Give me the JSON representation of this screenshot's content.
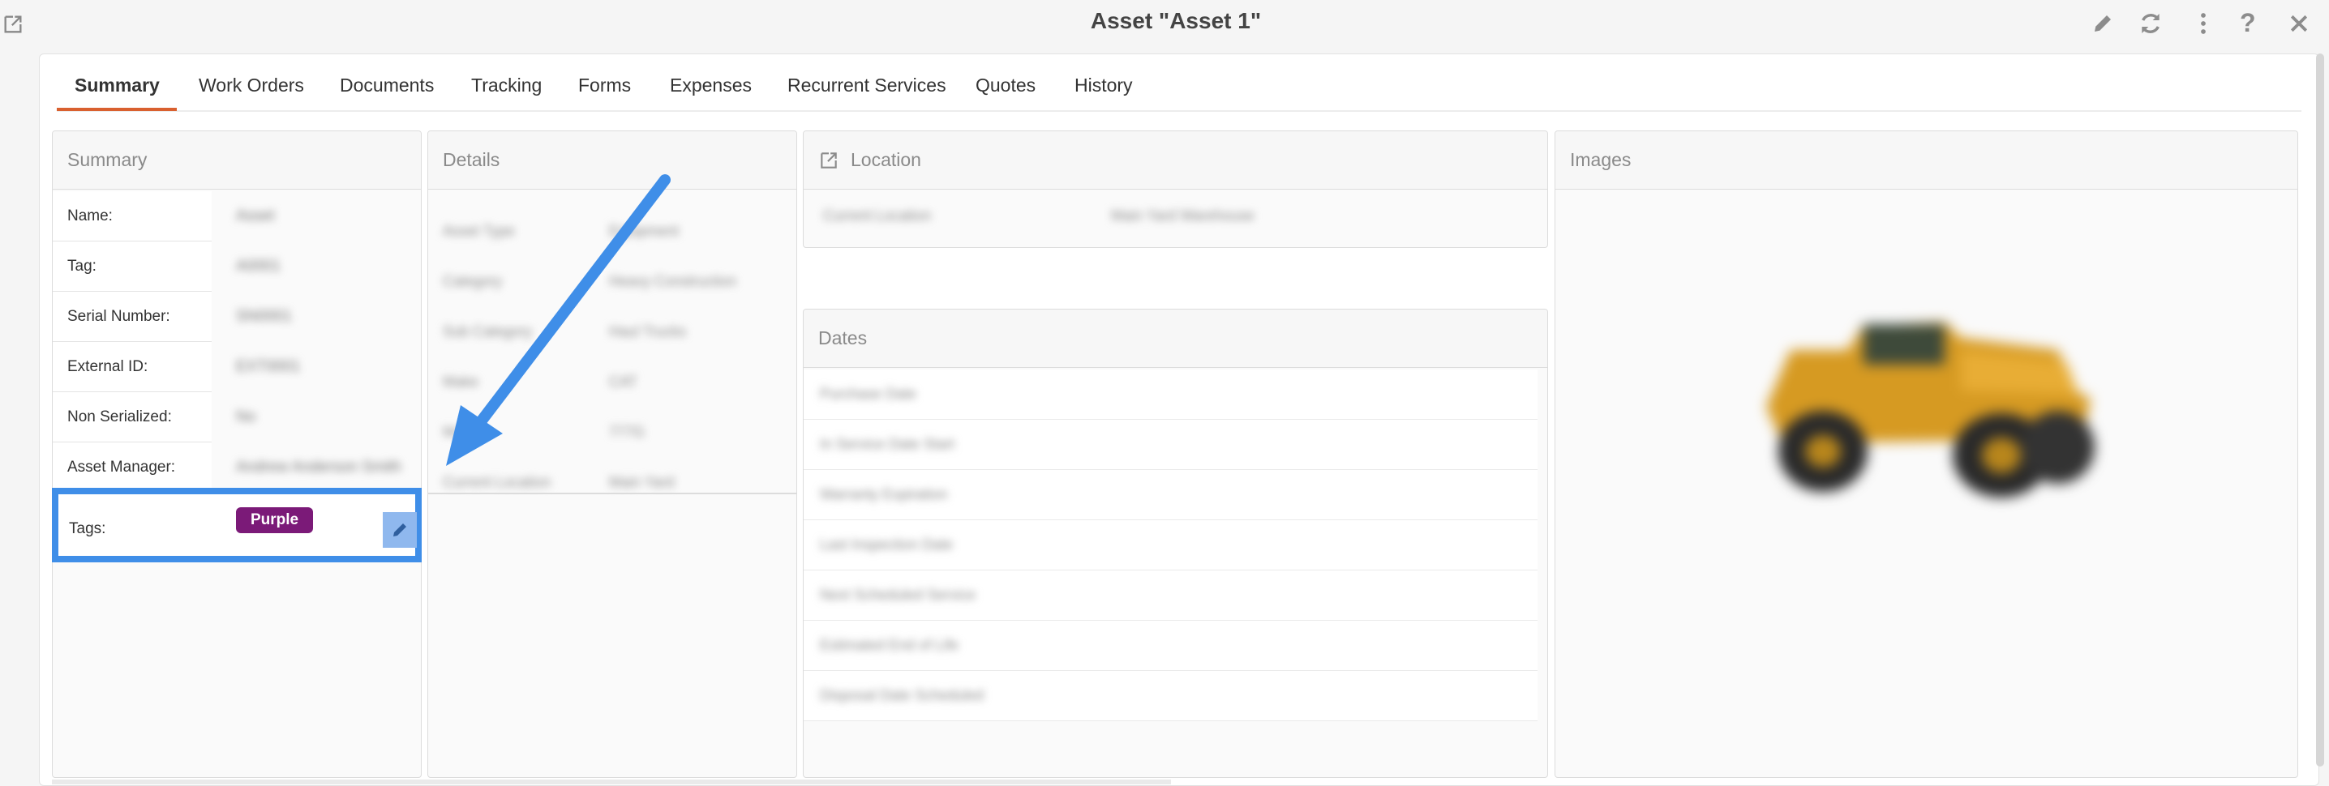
{
  "window": {
    "title": "Asset \"Asset 1\""
  },
  "tabs": [
    {
      "label": "Summary"
    },
    {
      "label": "Work Orders"
    },
    {
      "label": "Documents"
    },
    {
      "label": "Tracking"
    },
    {
      "label": "Forms"
    },
    {
      "label": "Expenses"
    },
    {
      "label": "Recurrent Services"
    },
    {
      "label": "Quotes"
    },
    {
      "label": "History"
    }
  ],
  "summary": {
    "title": "Summary",
    "rows": [
      {
        "label": "Name:",
        "value": "Asset"
      },
      {
        "label": "Tag:",
        "value": "A0001"
      },
      {
        "label": "Serial Number:",
        "value": "SN0001"
      },
      {
        "label": "External ID:",
        "value": "EXT0001"
      },
      {
        "label": "Non Serialized:",
        "value": "No"
      },
      {
        "label": "Asset Manager:",
        "value": "Andrew Anderson Smith"
      }
    ],
    "tags_label": "Tags:",
    "tag": {
      "text": "Purple",
      "color": "#7b1a78"
    }
  },
  "details": {
    "title": "Details",
    "rows": [
      {
        "label": "Asset Type",
        "value": "Equipment"
      },
      {
        "label": "Category",
        "value": "Heavy Construction"
      },
      {
        "label": "Sub Category",
        "value": "Haul Trucks"
      },
      {
        "label": "Make",
        "value": "CAT"
      },
      {
        "label": "Model",
        "value": "777G"
      },
      {
        "label": "Current Location",
        "value": "Main Yard"
      }
    ]
  },
  "location": {
    "title": "Location",
    "row": {
      "label": "Current Location",
      "value": "Main Yard Warehouse"
    }
  },
  "dates": {
    "title": "Dates",
    "rows": [
      {
        "label": "Purchase Date"
      },
      {
        "label": "In Service Date Start"
      },
      {
        "label": "Warranty Expiration"
      },
      {
        "label": "Last Inspection Date"
      },
      {
        "label": "Next Scheduled Service"
      },
      {
        "label": "Estimated End of Life"
      },
      {
        "label": "Disposal Date Scheduled"
      }
    ]
  },
  "images": {
    "title": "Images"
  },
  "colors": {
    "accent_tab": "#d9602f",
    "highlight": "#3f8ee8",
    "tag": "#7b1a78"
  }
}
